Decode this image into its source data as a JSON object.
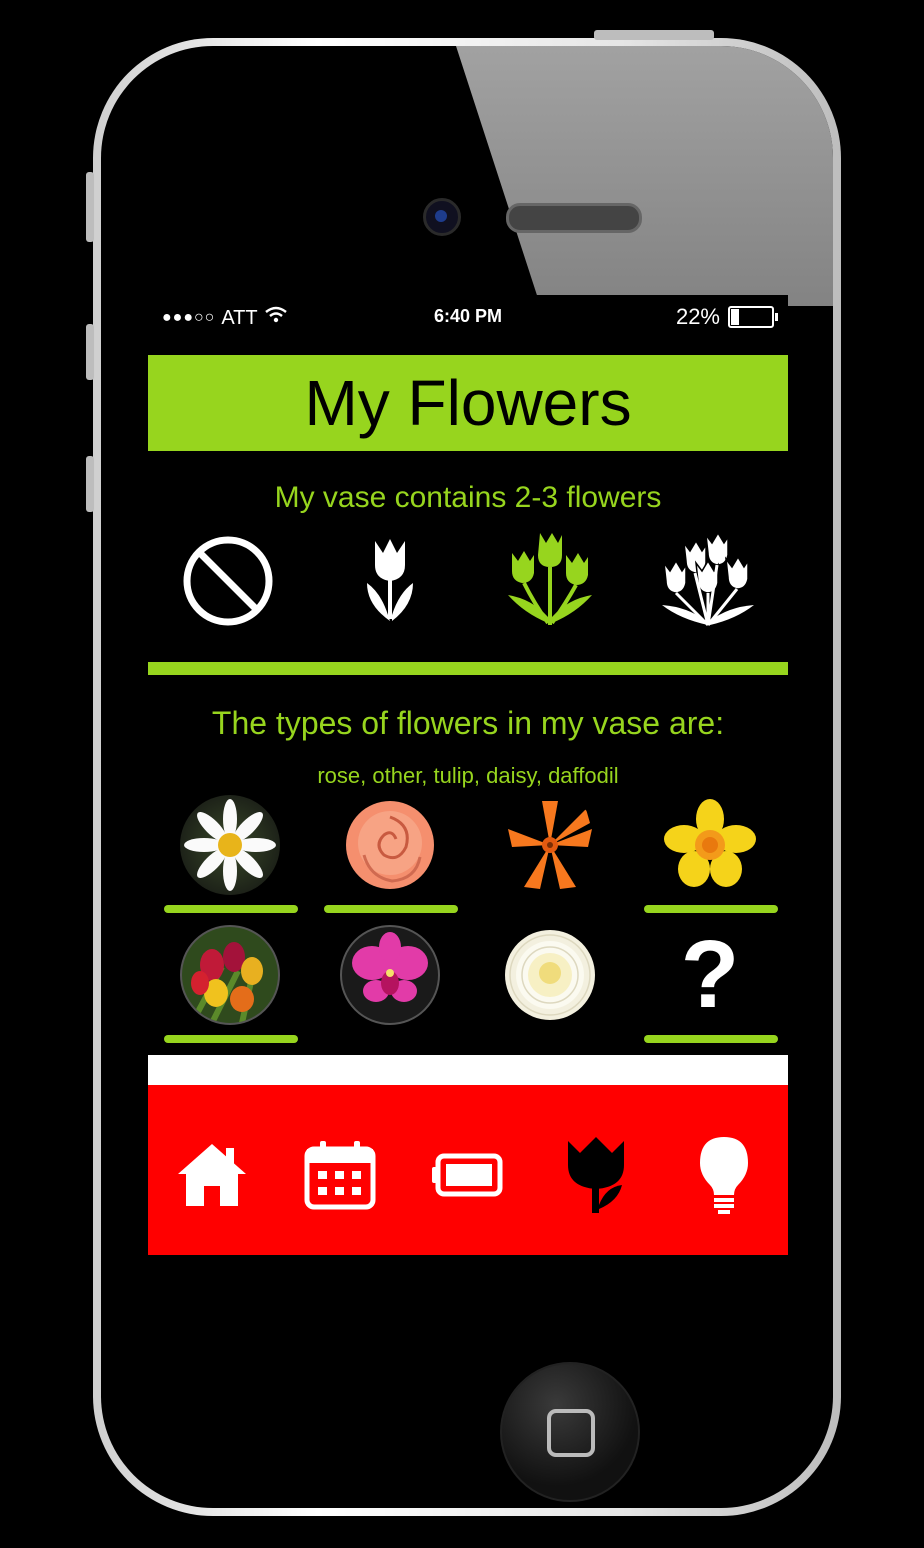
{
  "status_bar": {
    "signal": "●●●○○",
    "carrier": "ATT",
    "time": "6:40 PM",
    "battery_text": "22%",
    "battery_level": 0.22
  },
  "header": {
    "title": "My Flowers"
  },
  "vase_count": {
    "title": "My vase contains 2-3 flowers",
    "options": [
      {
        "icon": "no-flowers-icon",
        "selected": false
      },
      {
        "icon": "single-flower-icon",
        "selected": false
      },
      {
        "icon": "few-flowers-icon",
        "selected": true
      },
      {
        "icon": "many-flowers-icon",
        "selected": false
      }
    ]
  },
  "flower_types": {
    "title": "The types of flowers in my vase are:",
    "selected_list": "rose, other, tulip, daisy, daffodil",
    "items": [
      {
        "kind": "daisy",
        "selected": true
      },
      {
        "kind": "rose",
        "selected": true
      },
      {
        "kind": "lily",
        "selected": false
      },
      {
        "kind": "daffodil",
        "selected": true
      },
      {
        "kind": "tulip",
        "selected": true
      },
      {
        "kind": "orchid",
        "selected": false
      },
      {
        "kind": "chrysanthemum",
        "selected": false
      },
      {
        "kind": "other",
        "selected": true,
        "label": "?"
      }
    ]
  },
  "tab_bar": {
    "tabs": [
      {
        "icon": "home-icon",
        "active": false
      },
      {
        "icon": "calendar-icon",
        "active": false
      },
      {
        "icon": "battery-icon",
        "active": false
      },
      {
        "icon": "tulip-icon",
        "active": true
      },
      {
        "icon": "lightbulb-icon",
        "active": false
      }
    ]
  },
  "colors": {
    "accent": "#97d51e",
    "tabbar": "#ff0000"
  }
}
